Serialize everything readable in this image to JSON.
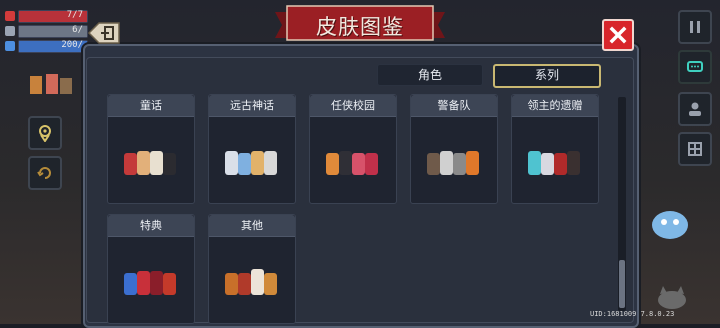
{
  "hud": {
    "hp_text": "7/7",
    "armor_text": "6/",
    "energy_text": "200/",
    "hp_fill": 1.0,
    "armor_fill": 1.0,
    "energy_fill": 1.0
  },
  "dialog": {
    "title": "皮肤图鉴",
    "back_icon": "back-arrow-icon",
    "close_icon": "close-x-icon"
  },
  "tabs": [
    {
      "label": "角色",
      "selected": false
    },
    {
      "label": "系列",
      "selected": true
    }
  ],
  "series": [
    {
      "name": "童话"
    },
    {
      "name": "远古神话"
    },
    {
      "name": "任侠校园"
    },
    {
      "name": "警备队"
    },
    {
      "name": "领主的遗赠"
    },
    {
      "name": "特典"
    },
    {
      "name": "其他"
    }
  ],
  "footer": {
    "uid": "UID:1681009  7.8.0.23"
  },
  "colors": {
    "accent_gold": "#c9b872",
    "close_red": "#d8262b",
    "banner_red": "#9b1f24"
  }
}
